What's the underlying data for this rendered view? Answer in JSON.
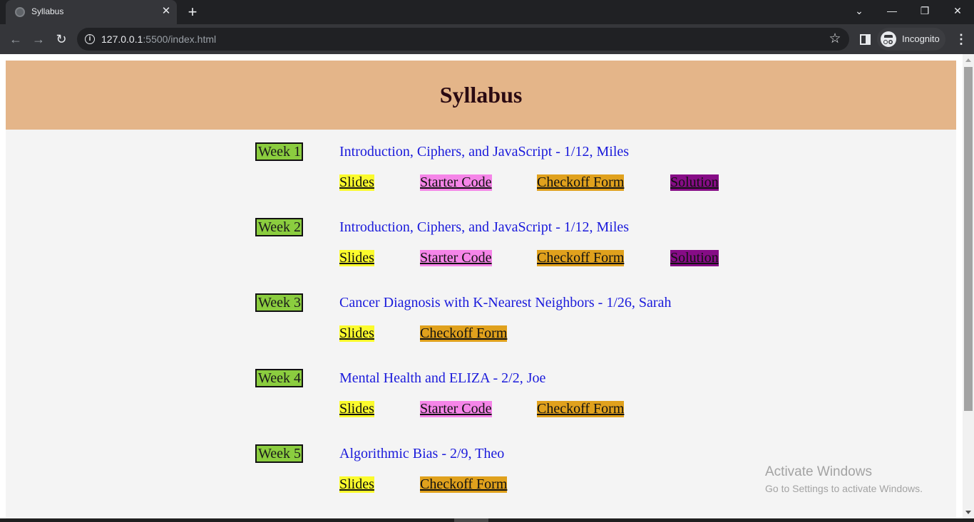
{
  "browser": {
    "tab_title": "Syllabus",
    "url_host": "127.0.0.1",
    "url_rest": ":5500/index.html",
    "profile_label": "Incognito",
    "icons": {
      "favicon": "globe-icon",
      "tab_close": "✕",
      "new_tab": "+",
      "tab_search": "⌄",
      "minimize": "—",
      "maximize": "❐",
      "close": "✕",
      "back": "←",
      "forward": "→",
      "reload": "↻",
      "info": "i",
      "star": "☆",
      "menu": "⋮"
    }
  },
  "page": {
    "title": "Syllabus",
    "link_labels": {
      "slides": "Slides",
      "starter": "Starter Code",
      "checkoff": "Checkoff Form",
      "solution": "Solution"
    },
    "weeks": [
      {
        "label": "Week 1",
        "topic": "Introduction, Ciphers, and JavaScript - 1/12, Miles",
        "links": [
          "Slides",
          "Starter Code",
          "Checkoff Form",
          "Solution"
        ]
      },
      {
        "label": "Week 2",
        "topic": "Introduction, Ciphers, and JavaScript - 1/12, Miles",
        "links": [
          "Slides",
          "Starter Code",
          "Checkoff Form",
          "Solution"
        ]
      },
      {
        "label": "Week 3",
        "topic": "Cancer Diagnosis with K-Nearest Neighbors - 1/26, Sarah",
        "links": [
          "Slides",
          "Checkoff Form"
        ]
      },
      {
        "label": "Week 4",
        "topic": "Mental Health and ELIZA - 2/2, Joe",
        "links": [
          "Slides",
          "Starter Code",
          "Checkoff Form"
        ]
      },
      {
        "label": "Week 5",
        "topic": "Algorithmic Bias - 2/9, Theo",
        "links": [
          "Slides",
          "Checkoff Form"
        ]
      }
    ]
  },
  "overlay": {
    "title": "Activate Windows",
    "subtitle": "Go to Settings to activate Windows."
  },
  "colors": {
    "header_bg": "#e4b589",
    "week_badge": "#8bcd3f",
    "topic_text": "#1a1adb",
    "slides_bg": "#fbfb2c",
    "starter_bg": "#f585e8",
    "checkoff_bg": "#e0a11d",
    "solution_bg": "#860c86"
  }
}
